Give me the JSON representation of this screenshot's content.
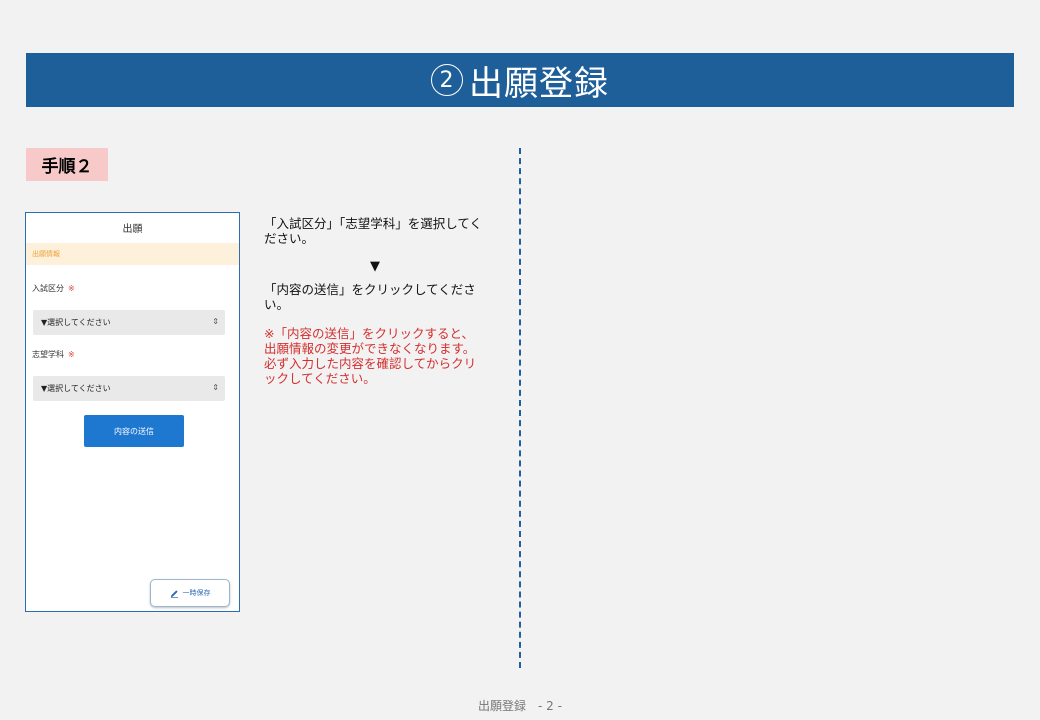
{
  "header": {
    "number": "2",
    "title": "出願登録"
  },
  "step_label": "手順２",
  "phone": {
    "title": "出願",
    "section_band": "出願情報",
    "field1": {
      "label": "入試区分",
      "required_mark": "※",
      "select_value": "▼選択してください",
      "chevron": "⇕"
    },
    "field2": {
      "label": "志望学科",
      "required_mark": "※",
      "select_value": "▼選択してください",
      "chevron": "⇕"
    },
    "send_button": "内容の送信",
    "temp_save_button": "一時保存"
  },
  "instructions": {
    "step1": "「入試区分」「志望学科」を選択してください。",
    "arrow": "▼",
    "step2": "「内容の送信」をクリックしてください。",
    "note": "※「内容の送信」をクリックすると、出願情報の変更ができなくなります。必ず入力した内容を確認してからクリックしてください。"
  },
  "footer": "出願登録　- 2 -",
  "colors": {
    "header_bg": "#1f5f99",
    "step_label_bg": "#f8c9c9",
    "send_button_bg": "#1e78d0",
    "note_text": "#d32f2f",
    "divider": "#2160a0"
  }
}
